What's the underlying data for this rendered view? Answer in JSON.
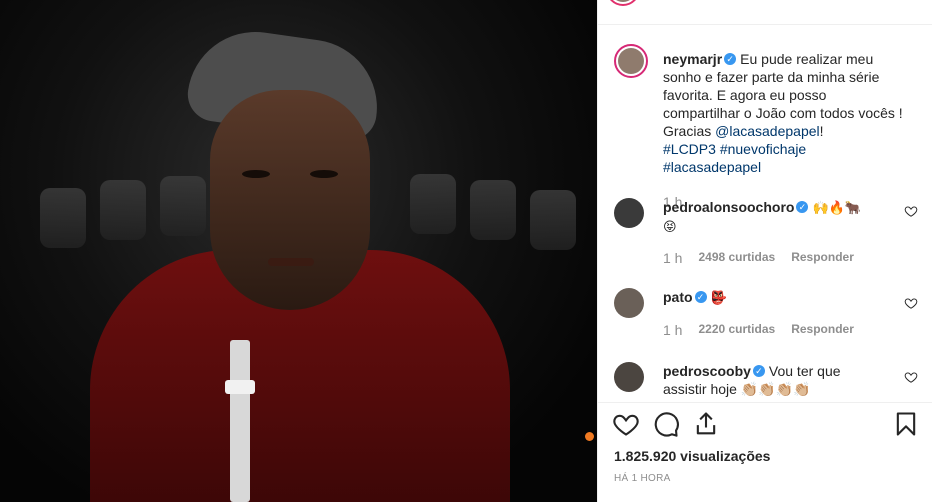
{
  "post": {
    "author": "neymarjr",
    "caption_line1": "Eu pude realizar meu",
    "caption_line2": "sonho e fazer parte da minha série",
    "caption_line3": "favorita. E agora eu posso",
    "caption_line4": "compartilhar o João com todos vocês !",
    "caption_gracias": "Gracias",
    "caption_mention": "@lacasadepapel",
    "caption_end": "!",
    "hashtags": [
      "#LCDP3",
      "#nuevofichaje",
      "#lacasadepapel"
    ],
    "caption_time": "1 h"
  },
  "comments": [
    {
      "user": "pedroalonsoochoro",
      "text_line1": "🙌🔥🐂",
      "text_line2": "😝",
      "time": "1 h",
      "likes": "2498 curtidas",
      "reply": "Responder"
    },
    {
      "user": "pato",
      "text_line1": "👺",
      "time": "1 h",
      "likes": "2220 curtidas",
      "reply": "Responder"
    },
    {
      "user": "pedroscooby",
      "text_line1": "Vou ter que",
      "text_line2": "assistir hoje 👏🏼👏🏼👏🏼👏🏼"
    }
  ],
  "footer": {
    "views": "1.825.920 visualizações",
    "posted": "HÁ 1 HORA"
  },
  "icons": {
    "like": "heart-icon",
    "comment": "comment-icon",
    "share": "share-icon",
    "save": "bookmark-icon",
    "verified": "verified-badge-icon"
  },
  "colors": {
    "verified": "#3897f0",
    "link": "#00376b",
    "muted": "#8e8e8e",
    "story_ring": "#d62976"
  }
}
